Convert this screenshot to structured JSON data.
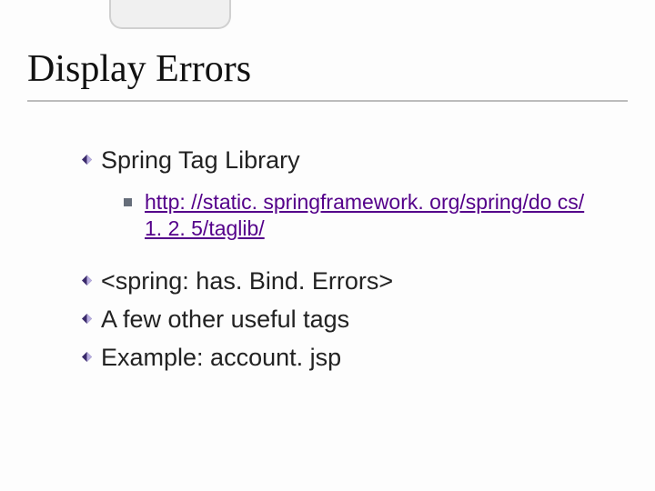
{
  "title": "Display Errors",
  "bullets": {
    "b1": "Spring Tag Library",
    "b1_sub_link": "http: //static. springframework. org/spring/do cs/1. 2. 5/taglib/",
    "b2": "<spring: has. Bind. Errors>",
    "b3": "A few other useful tags",
    "b4": "Example: account. jsp"
  }
}
